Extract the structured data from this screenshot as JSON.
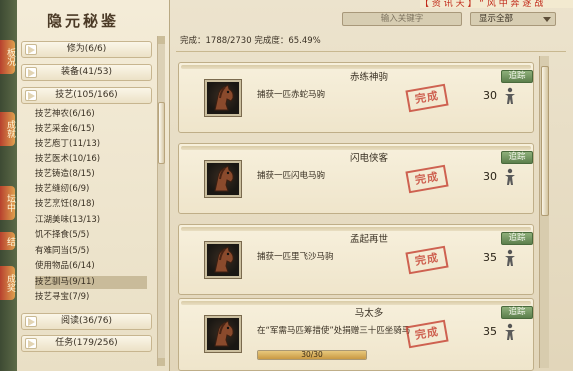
{
  "top_banner": "【 资 讯 天 】  “ 风 中 奔 逐 战",
  "left_edge_tabs": [
    "板况",
    "成就",
    "坛中",
    "结",
    "成奖"
  ],
  "left_title": "隐元秘鉴",
  "categories_top": [
    {
      "label": "修为(6/6)"
    },
    {
      "label": "装备(41/53)"
    },
    {
      "label": "技艺(105/166)"
    }
  ],
  "sub_items": [
    "技艺神农(6/16)",
    "技艺采金(6/15)",
    "技艺庖丁(11/13)",
    "技艺医术(10/16)",
    "技艺铸造(8/15)",
    "技艺缝纫(6/9)",
    "技艺烹饪(8/18)",
    "江湖美味(13/13)",
    "饥不择食(5/5)",
    "有难同当(5/5)",
    "使用物品(6/14)",
    "技艺驯马(9/11)",
    "技艺寻宝(7/9)"
  ],
  "selected_sub_item_index": 11,
  "categories_bottom": [
    {
      "label": "阅读(36/76)"
    },
    {
      "label": "任务(179/256)"
    }
  ],
  "header": {
    "search_placeholder": "输入关键字",
    "filter_selected": "显示全部",
    "progress_text": "完成：1788/2730  完成度：65.49%"
  },
  "track_label": "追踪",
  "completed_seal": "完成",
  "entries": [
    {
      "name": "赤练神驹",
      "desc": "捕获一匹赤蛇马驹",
      "points": "30",
      "progress": null,
      "portrait": "horse-portrait-icon",
      "reward": "reward-figure-icon"
    },
    {
      "name": "闪电侠客",
      "desc": "捕获一匹闪电马驹",
      "points": "30",
      "progress": null,
      "portrait": "horse-portrait-icon",
      "reward": "reward-figure-icon"
    },
    {
      "name": "孟起再世",
      "desc": "捕获一匹里飞沙马驹",
      "points": "35",
      "progress": null,
      "portrait": "horse-portrait-icon",
      "reward": "reward-figure-icon"
    },
    {
      "name": "马太多",
      "desc": "在“军需马匹筹措使”处捐赠三十匹坐骑马",
      "points": "35",
      "progress": {
        "text": "30/30",
        "fraction": 1.0
      },
      "portrait": "horse-portrait-icon",
      "reward": "reward-figure-icon"
    }
  ],
  "colors": {
    "track_button": "#6f9460",
    "seal": "#c84a3a",
    "progress_fill": "#d8ad5a"
  }
}
